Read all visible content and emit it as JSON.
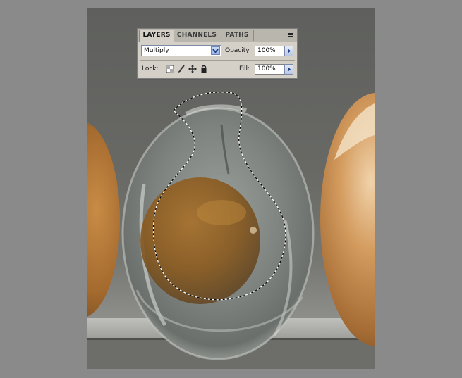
{
  "layers_panel": {
    "tabs": [
      {
        "label": "LAYERS",
        "active": true
      },
      {
        "label": "CHANNELS",
        "active": false
      },
      {
        "label": "PATHS",
        "active": false
      }
    ],
    "menu_icon": "panel-menu-icon",
    "blend_mode": "Multiply",
    "opacity_label": "Opacity:",
    "opacity_value": "100%",
    "lock_label": "Lock:",
    "lock_icons": [
      "lock-transparent-pixels-icon",
      "lock-image-pixels-icon",
      "lock-position-icon",
      "lock-all-icon"
    ],
    "fill_label": "Fill:",
    "fill_value": "100%"
  },
  "colors": {
    "workspace": "#8a8a8a",
    "panel": "#d4d0c8",
    "tab_bar": "#b9b6ae",
    "yolk": "#8a5a1e",
    "brown_egg": "#b8762f"
  }
}
